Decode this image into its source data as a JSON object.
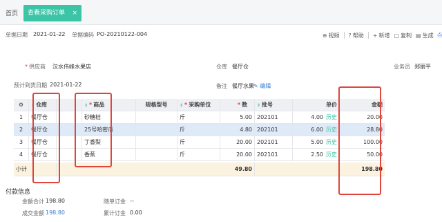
{
  "tabs": {
    "home": "首页",
    "active": "查看采购订单",
    "close": "×"
  },
  "header": {
    "doc_date_label": "单据日期",
    "doc_date": "2021-01-22",
    "doc_no_label": "单据编码",
    "doc_no": "PO-20210122-004"
  },
  "toolbar": {
    "video": "视频",
    "help": "帮助",
    "new": "新增",
    "copy": "复制",
    "generate": "生成"
  },
  "form": {
    "supplier_label": "供应商",
    "supplier": "汉水伟峰水果店",
    "warehouse_label": "仓库",
    "warehouse": "餐厅仓",
    "salesman_label": "业务员",
    "salesman": "郑丽平",
    "arrival_label": "预计到货日期",
    "arrival": "2021-01-22",
    "remark_label": "备注",
    "remark": "餐厅水果",
    "edit": "编辑"
  },
  "table": {
    "headers": {
      "warehouse": "仓库",
      "product": "商品",
      "spec": "规格型号",
      "unit": "采购单位",
      "qty": "数量",
      "batch": "批号",
      "price": "单价",
      "amount": "金额"
    },
    "rows": [
      {
        "no": "1",
        "warehouse": "餐厅仓",
        "product": "砂糖桔",
        "unit": "斤",
        "qty": "5.00",
        "batch": "202101",
        "price": "4.00",
        "hist": "历史",
        "amount": "20.00"
      },
      {
        "no": "2",
        "warehouse": "餐厅仓",
        "product": "25号哈密瓜",
        "unit": "斤",
        "qty": "4.80",
        "batch": "202101",
        "price": "6.00",
        "hist": "历史",
        "amount": "28.80"
      },
      {
        "no": "3",
        "warehouse": "餐厅仓",
        "product": "丁香梨",
        "unit": "斤",
        "qty": "20.00",
        "batch": "202101",
        "price": "5.00",
        "hist": "历史",
        "amount": "100.00"
      },
      {
        "no": "4",
        "warehouse": "餐厅仓",
        "product": "香蕉",
        "unit": "斤",
        "qty": "20.00",
        "batch": "202101",
        "price": "2.50",
        "hist": "历史",
        "amount": "50.00"
      }
    ],
    "subtotal": {
      "label": "小计",
      "qty": "49.80",
      "amount": "198.80"
    }
  },
  "payment": {
    "title": "付款信息",
    "total_label": "金额合计",
    "total": "198.80",
    "deal_label": "成交金额",
    "deal": "198.80",
    "deposit_label": "随单订金",
    "deposit": "--",
    "cum_deposit_label": "累计订金",
    "cum_deposit": "0.00"
  },
  "colors": {
    "accent": "#3cc4a6",
    "highlight": "#e0443a",
    "link": "#3a7bd5"
  }
}
